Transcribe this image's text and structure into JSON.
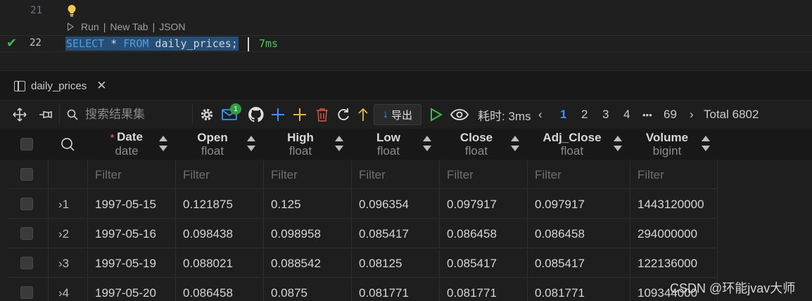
{
  "editor": {
    "line_21": "21",
    "line_22": "22",
    "codelens": {
      "run": "Run",
      "sep1": "|",
      "new_tab": "New Tab",
      "sep2": "|",
      "json": "JSON"
    },
    "sql": {
      "select": "SELECT",
      "star": " * ",
      "from": "FROM",
      "rest": " daily_prices;"
    },
    "timing": "7ms"
  },
  "tab": {
    "label": "daily_prices",
    "close": "✕"
  },
  "toolbar": {
    "search_placeholder": "搜索结果集",
    "badge_count": "1",
    "export_label": "导出",
    "elapsed": "耗时: 3ms",
    "pages": [
      "1",
      "2",
      "3",
      "4"
    ],
    "ellipsis": "•••",
    "last_page": "69",
    "total": "Total 6802",
    "prev": "‹",
    "next": "›"
  },
  "columns": [
    {
      "name": "Date",
      "type": "date",
      "required": "*"
    },
    {
      "name": "Open",
      "type": "float"
    },
    {
      "name": "High",
      "type": "float"
    },
    {
      "name": "Low",
      "type": "float"
    },
    {
      "name": "Close",
      "type": "float"
    },
    {
      "name": "Adj_Close",
      "type": "float"
    },
    {
      "name": "Volume",
      "type": "bigint"
    }
  ],
  "filter_placeholder": "Filter",
  "rows": [
    {
      "n": "1",
      "cells": [
        "1997-05-15",
        "0.121875",
        "0.125",
        "0.096354",
        "0.097917",
        "0.097917",
        "1443120000"
      ]
    },
    {
      "n": "2",
      "cells": [
        "1997-05-16",
        "0.098438",
        "0.098958",
        "0.085417",
        "0.086458",
        "0.086458",
        "294000000"
      ]
    },
    {
      "n": "3",
      "cells": [
        "1997-05-19",
        "0.088021",
        "0.088542",
        "0.08125",
        "0.085417",
        "0.085417",
        "122136000"
      ]
    },
    {
      "n": "4",
      "cells": [
        "1997-05-20",
        "0.086458",
        "0.0875",
        "0.081771",
        "0.081771",
        "0.081771",
        "109344000"
      ]
    }
  ],
  "watermark": "CSDN @环能jvav大师",
  "colors": {
    "accent": "#3794ff",
    "success": "#3fb950",
    "delete": "#c74e39",
    "add_yellow": "#e2c08d"
  }
}
